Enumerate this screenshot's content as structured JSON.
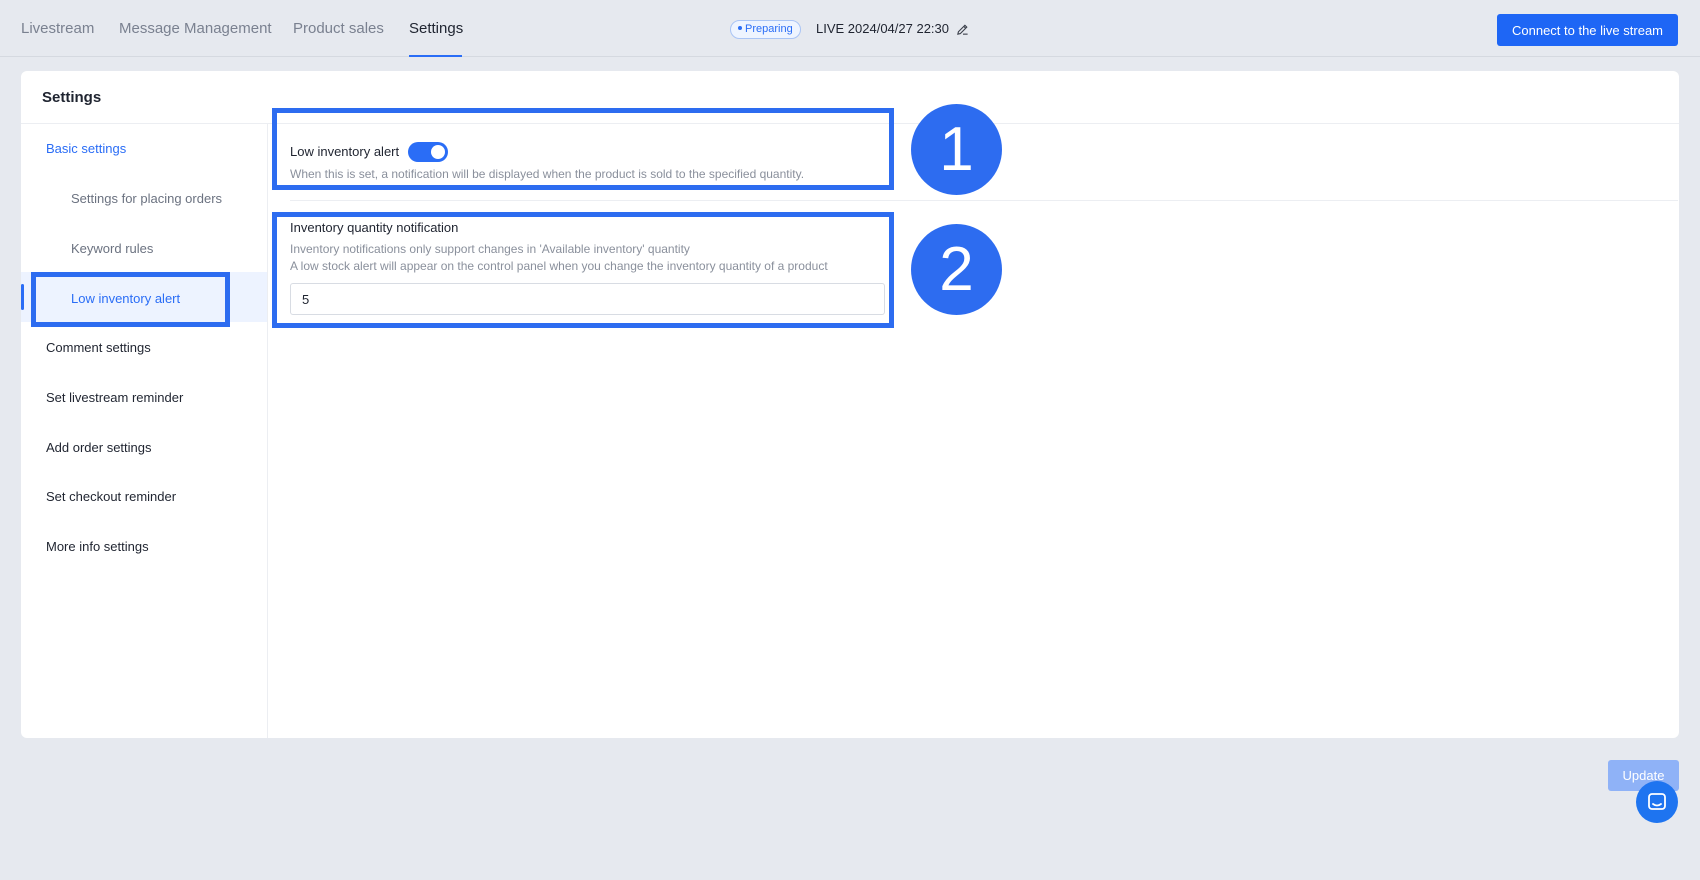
{
  "top_nav": {
    "tabs": [
      {
        "label": "Livestream"
      },
      {
        "label": "Message Management"
      },
      {
        "label": "Product sales"
      },
      {
        "label": "Settings",
        "active": true
      }
    ],
    "status_badge": "Preparing",
    "live_title": "LIVE 2024/04/27 22:30",
    "edit_icon": "pencil-icon",
    "connect_button": "Connect to the live stream"
  },
  "card": {
    "title": "Settings"
  },
  "sidebar": {
    "items": [
      {
        "label": "Basic settings",
        "level": "group",
        "expanded": true
      },
      {
        "label": "Settings for placing orders",
        "level": "sub"
      },
      {
        "label": "Keyword rules",
        "level": "sub"
      },
      {
        "label": "Low inventory alert",
        "level": "sub",
        "active": true
      },
      {
        "label": "Comment settings",
        "level": "group"
      },
      {
        "label": "Set livestream reminder",
        "level": "group"
      },
      {
        "label": "Add order settings",
        "level": "group"
      },
      {
        "label": "Set checkout reminder",
        "level": "group"
      },
      {
        "label": "More info settings",
        "level": "group"
      }
    ]
  },
  "low_inventory": {
    "label": "Low inventory alert",
    "enabled": true,
    "description": "When this is set, a notification will be displayed when the product is sold to the specified quantity."
  },
  "inventory_notification": {
    "title": "Inventory quantity notification",
    "note_1": "Inventory notifications only support changes in 'Available inventory' quantity",
    "note_2": "A low stock alert will appear on the control panel when you change the inventory quantity of a product",
    "value": "5"
  },
  "annotations": {
    "marker_1": "1",
    "marker_2": "2",
    "color": "#2d6cf0"
  },
  "footer": {
    "update_button": "Update",
    "chat_icon": "chat-icon"
  },
  "colors": {
    "accent": "#2a6df6",
    "background": "#e6e9ef"
  }
}
